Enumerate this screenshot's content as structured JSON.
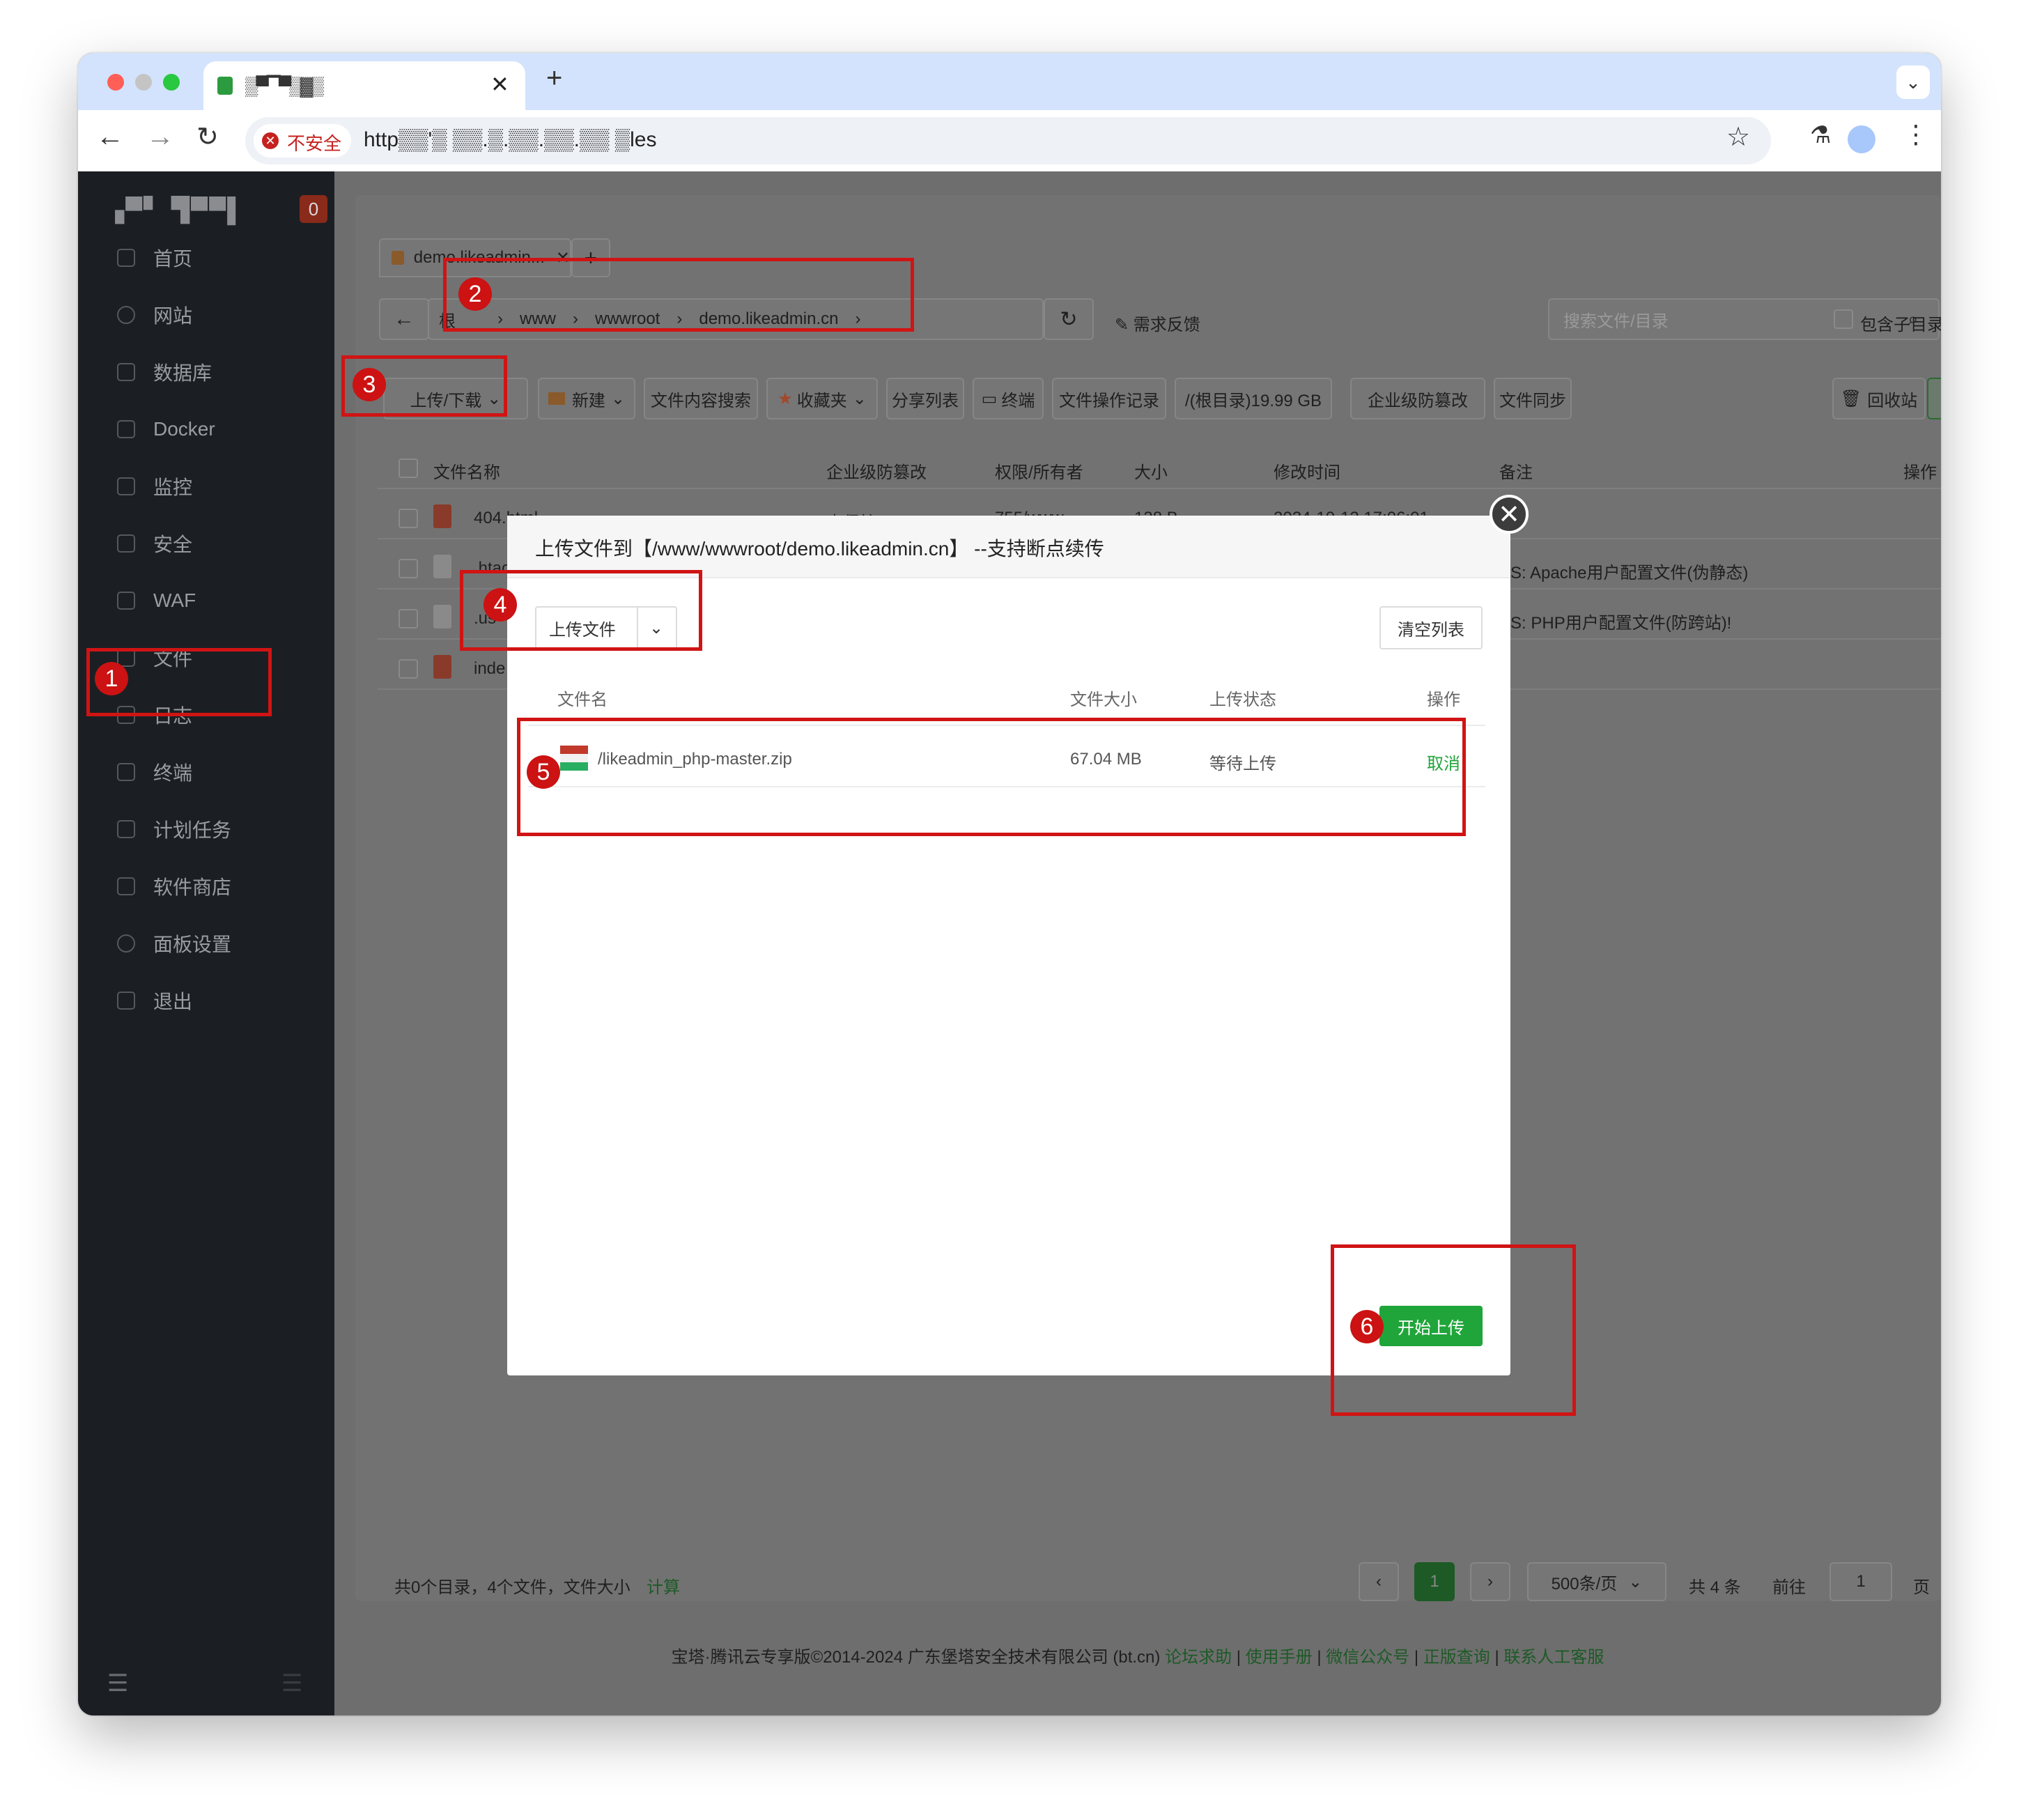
{
  "browser": {
    "tab_title": "▒▀▔▀▒▓▒",
    "security_label": "不安全",
    "url_text": "http▒▒'▒ ▒▒.▒.▒▒.▒▒.▒▒ ▒les"
  },
  "sidebar": {
    "logo_text": "▗▀▘ ▜▀▀▌",
    "badge_count": "0",
    "items": [
      {
        "label": "首页"
      },
      {
        "label": "网站"
      },
      {
        "label": "数据库"
      },
      {
        "label": "Docker"
      },
      {
        "label": "监控"
      },
      {
        "label": "安全"
      },
      {
        "label": "WAF"
      },
      {
        "label": "文件"
      },
      {
        "label": "日志"
      },
      {
        "label": "终端"
      },
      {
        "label": "计划任务"
      },
      {
        "label": "软件商店"
      },
      {
        "label": "面板设置"
      },
      {
        "label": "退出"
      }
    ]
  },
  "file_tab": {
    "label": "demo.likeadmin..."
  },
  "path": {
    "root_partial": "根",
    "segments": [
      "www",
      "wwwroot",
      "demo.likeadmin.cn"
    ],
    "feedback": "需求反馈",
    "search_placeholder": "搜索文件/目录",
    "include_subdir": "包含子目录"
  },
  "toolbar": {
    "upload_download": "上传/下载",
    "new": "新建",
    "content_search": "文件内容搜索",
    "favorites": "收藏夹",
    "share_list": "分享列表",
    "terminal": "终端",
    "operation_log": "文件操作记录",
    "disk": "/(根目录)19.99 GB",
    "tamper": "企业级防篡改",
    "sync": "文件同步",
    "recycle": "回收站"
  },
  "table": {
    "headers": [
      "文件名称",
      "企业级防篡改",
      "权限/所有者",
      "大小",
      "修改时间",
      "备注",
      "操作"
    ],
    "rows": [
      {
        "name": "404.html",
        "protect": "未保护",
        "perm": "755/www",
        "size": "138 B",
        "mtime": "2024-10-12 17:06:01",
        "note": ""
      },
      {
        "name": ".htac",
        "protect": "",
        "perm": "",
        "size": "",
        "mtime": "",
        "note": "PS: Apache用户配置文件(伪静态)"
      },
      {
        "name": ".us",
        "protect": "",
        "perm": "",
        "size": "",
        "mtime": "",
        "note": "PS: PHP用户配置文件(防跨站)!"
      },
      {
        "name": "inde",
        "protect": "",
        "perm": "",
        "size": "",
        "mtime": "",
        "note": ""
      }
    ]
  },
  "footer_stats": {
    "text": "共0个目录，4个文件，文件大小",
    "calc": "计算"
  },
  "pagination": {
    "current": "1",
    "per_page": "500条/页",
    "total": "共 4 条",
    "goto_label": "前往",
    "goto_value": "1",
    "page_suffix": "页"
  },
  "copyright": {
    "text": "宝塔·腾讯云专享版©2014-2024 广东堡塔安全技术有限公司 (bt.cn)",
    "links": [
      "论坛求助",
      "使用手册",
      "微信公众号",
      "正版查询",
      "联系人工客服"
    ]
  },
  "modal": {
    "title": "上传文件到【/www/wwwroot/demo.likeadmin.cn】 --支持断点续传",
    "upload_button": "上传文件",
    "clear_button": "清空列表",
    "columns": [
      "文件名",
      "文件大小",
      "上传状态",
      "操作"
    ],
    "files": [
      {
        "name": "/likeadmin_php-master.zip",
        "size": "67.04 MB",
        "status": "等待上传",
        "action": "取消"
      }
    ],
    "start_button": "开始上传"
  },
  "annotations": [
    "1",
    "2",
    "3",
    "4",
    "5",
    "6"
  ],
  "colors": {
    "accent_green": "#20a53a",
    "annotation_red": "#d01414",
    "sidebar_bg": "#1b1f23"
  }
}
